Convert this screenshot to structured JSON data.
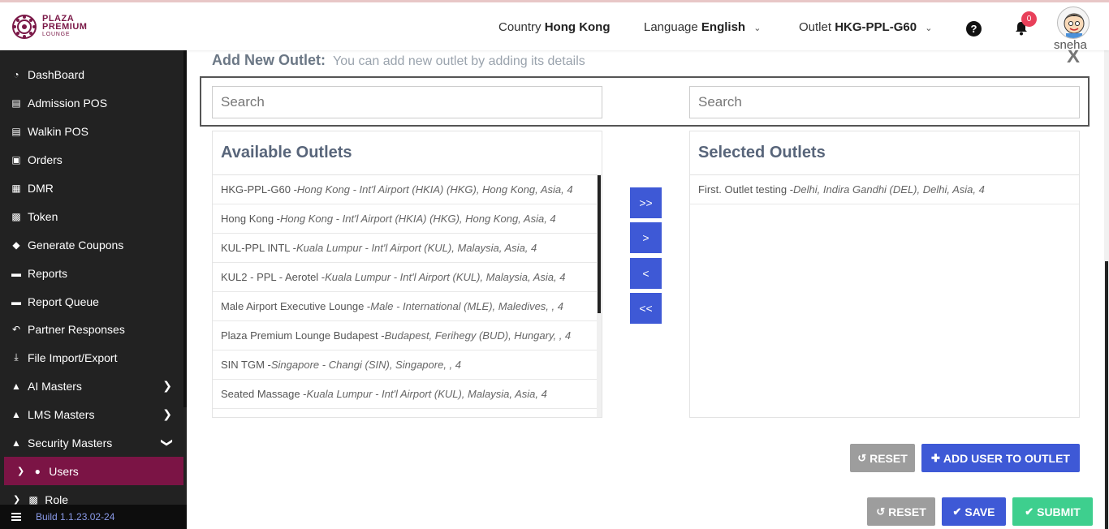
{
  "brand": {
    "line1": "PLAZA",
    "line2": "PREMIUM",
    "line3": "LOUNGE",
    "color": "#7a1847"
  },
  "header": {
    "country_label": "Country",
    "country_value": "Hong Kong",
    "language_label": "Language",
    "language_value": "English",
    "outlet_label": "Outlet",
    "outlet_value": "HKG-PPL-G60",
    "notification_count": "0",
    "user_name": "sneha"
  },
  "sidebar": {
    "items": [
      {
        "label": "DashBoard",
        "icon": "dashboard-icon"
      },
      {
        "label": "Admission POS",
        "icon": "id-card-icon"
      },
      {
        "label": "Walkin POS",
        "icon": "id-card-icon"
      },
      {
        "label": "Orders",
        "icon": "cart-icon"
      },
      {
        "label": "DMR",
        "icon": "calendar-icon"
      },
      {
        "label": "Token",
        "icon": "document-icon"
      },
      {
        "label": "Generate Coupons",
        "icon": "tag-icon"
      },
      {
        "label": "Reports",
        "icon": "book-icon"
      },
      {
        "label": "Report Queue",
        "icon": "book-icon"
      },
      {
        "label": "Partner Responses",
        "icon": "reply-icon"
      },
      {
        "label": "File Import/Export",
        "icon": "download-icon"
      },
      {
        "label": "AI Masters",
        "icon": "sitemap-icon"
      },
      {
        "label": "LMS Masters",
        "icon": "sitemap-icon"
      },
      {
        "label": "Security Masters",
        "icon": "sitemap-icon"
      },
      {
        "label": "Users",
        "icon": "user-icon"
      },
      {
        "label": "Role",
        "icon": "role-icon"
      }
    ],
    "build": "Build 1.1.23.02-24",
    "active_color": "#7b1445"
  },
  "modal": {
    "title": "Add New Outlet:",
    "subtitle": "You can add new outlet by adding its details",
    "close": "X",
    "search_left_placeholder": "Search",
    "search_right_placeholder": "Search",
    "available_title": "Available Outlets",
    "selected_title": "Selected Outlets",
    "available": [
      {
        "name": "HKG-PPL-G60 -",
        "detail": "Hong Kong - Int'l Airport (HKIA) (HKG), Hong Kong, Asia, 4"
      },
      {
        "name": "Hong Kong -",
        "detail": "Hong Kong - Int'l Airport (HKIA) (HKG), Hong Kong, Asia, 4"
      },
      {
        "name": "KUL-PPL INTL -",
        "detail": "Kuala Lumpur - Int'l Airport (KUL), Malaysia, Asia, 4"
      },
      {
        "name": "KUL2 - PPL - Aerotel -",
        "detail": "Kuala Lumpur - Int'l Airport (KUL), Malaysia, Asia, 4"
      },
      {
        "name": "Male Airport Executive Lounge -",
        "detail": "Male - International (MLE), Maledives, , 4"
      },
      {
        "name": "Plaza Premium Lounge Budapest -",
        "detail": "Budapest, Ferihegy (BUD), Hungary, , 4"
      },
      {
        "name": "SIN TGM -",
        "detail": "Singapore - Changi (SIN), Singapore, , 4"
      },
      {
        "name": "Seated Massage -",
        "detail": "Kuala Lumpur - Int'l Airport (KUL), Malaysia, Asia, 4"
      }
    ],
    "selected": [
      {
        "name": "First. Outlet testing -",
        "detail": "Delhi, Indira Gandhi (DEL), Delhi, Asia, 4"
      }
    ],
    "move_all_right": ">>",
    "move_right": ">",
    "move_left": "<",
    "move_all_left": "<<",
    "reset_inner": "RESET",
    "add_user_to_outlet": "ADD USER TO OUTLET"
  },
  "footer": {
    "reset": "RESET",
    "save": "SAVE",
    "submit": "SUBMIT"
  }
}
